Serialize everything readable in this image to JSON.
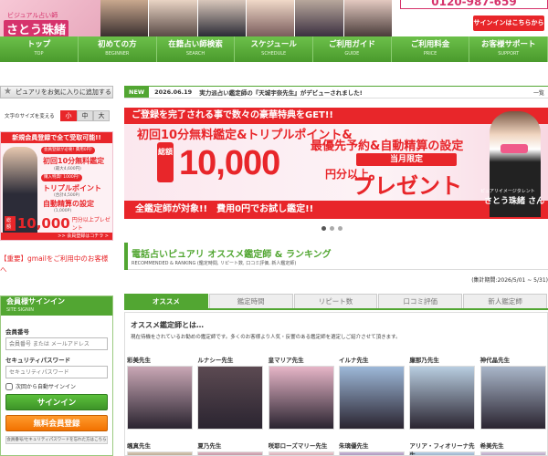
{
  "header": {
    "logo_small": "ビジュアル占い師",
    "logo_main": "さとう珠緒",
    "phone": "0120-987-659",
    "signin_label": "サインインはこちらから"
  },
  "nav": [
    {
      "label": "トップ",
      "sub": "TOP"
    },
    {
      "label": "初めての方",
      "sub": "BEGINNER"
    },
    {
      "label": "在籍占い師検索",
      "sub": "SEARCH"
    },
    {
      "label": "スケジュール",
      "sub": "SCHEDULE"
    },
    {
      "label": "ご利用ガイド",
      "sub": "GUIDE"
    },
    {
      "label": "ご利用料金",
      "sub": "PRICE"
    },
    {
      "label": "お客様サポート",
      "sub": "SUPPORT"
    }
  ],
  "sidebar": {
    "favorite": "ピュアリをお気に入りに追加する",
    "fontsize_label": "文字のサイズを変える",
    "fontsize_options": [
      "小",
      "中",
      "大"
    ],
    "promo": {
      "head": "新規会員登録で全て受取可能!!",
      "tag1": "会員登録が必要! 費用0円!",
      "line1": "初回10分無料鑑定",
      "small1": "(最大4,600円)",
      "tag2": "購入特典! 1000円!",
      "line2": "トリプルポイント",
      "small2": "(合計4,500P)",
      "line3": "自動精算の設定",
      "small3": "(1,000P)",
      "badge": "総額",
      "amount": "10,000",
      "unit": "円分以上プレゼント",
      "foot": ">> 会員登録はコチラ >"
    },
    "gmail_notice": "【重要】gmailをご利用中のお客様へ",
    "login": {
      "title": "会員様サインイン",
      "sub": "SITE SIGNIN",
      "id_label": "会員番号",
      "id_placeholder": "会員番号 または メールアドレス",
      "pw_label": "セキュリティパスワード",
      "pw_placeholder": "セキュリティパスワード",
      "remember": "次回から自動サインイン",
      "signin": "サインイン",
      "register": "無料会員登録",
      "forgot": "会員番号/セキュリティパスワードを忘れた方はこちら"
    }
  },
  "news": {
    "badge": "NEW",
    "date": "2026.06.19",
    "text": "実力派占い鑑定師の『天城宇奈先生』がデビューされました!",
    "all": "一覧"
  },
  "banner": {
    "top": "ご登録を完了される事で数々の豪華特典をGET!!",
    "line1": "初回10分無料鑑定&トリプルポイント&",
    "line2": "最優先予約&自動精算の設定",
    "total": "総額",
    "amount": "10,000",
    "unit": "円分以上",
    "limit": "当月限定",
    "present": "プレゼント",
    "bottom": "全鑑定師が対象!!　費用0円でお試し鑑定!!",
    "name_sub": "ピュアリイメージタレント",
    "name": "さとう珠緒 さん"
  },
  "ranking": {
    "title": "電話占いピュアリ オススメ鑑定師 & ランキング",
    "sub": "RECOMMENDED & RANKING (鑑定時間, リピート数, 口コミ評価, 新人鑑定師)",
    "period": "(集計期間:2026/5/01 ~ 5/31)",
    "tabs": [
      "オススメ",
      "鑑定時間",
      "リピート数",
      "口コミ評価",
      "新人鑑定師"
    ],
    "rec_title": "オススメ鑑定師とは…",
    "rec_desc": "現在待機をされているお勧めの鑑定師です。多くのお客様より人気・反響のある鑑定師を選定しご紹介させて頂きます。",
    "readers": [
      {
        "name": "彩美先生",
        "color": "#c9a7b5"
      },
      {
        "name": "ルナシー先生",
        "color": "#5c4a52"
      },
      {
        "name": "皇マリア先生",
        "color": "#e6b5c7"
      },
      {
        "name": "イルナ先生",
        "color": "#9db8d8"
      },
      {
        "name": "廉那乃先生",
        "color": "#b8cde0"
      },
      {
        "name": "神代晶先生",
        "color": "#a9b6c9"
      }
    ],
    "readers2": [
      {
        "name": "颯真先生",
        "color": "#d9c9b0"
      },
      {
        "name": "夏乃先生",
        "color": "#e0b3c0"
      },
      {
        "name": "咲耶ローズマリー先生",
        "color": "#f0cbd3"
      },
      {
        "name": "朱璃優先生",
        "color": "#c9b4d9"
      },
      {
        "name": "アリア・フィオリーナ先生",
        "color": "#b7d1e8"
      },
      {
        "name": "希美先生",
        "color": "#d4c4e0"
      }
    ]
  },
  "colors": {
    "green": "#52a632",
    "red": "#e8262a",
    "pink": "#d6336c",
    "orange": "#f27100"
  }
}
